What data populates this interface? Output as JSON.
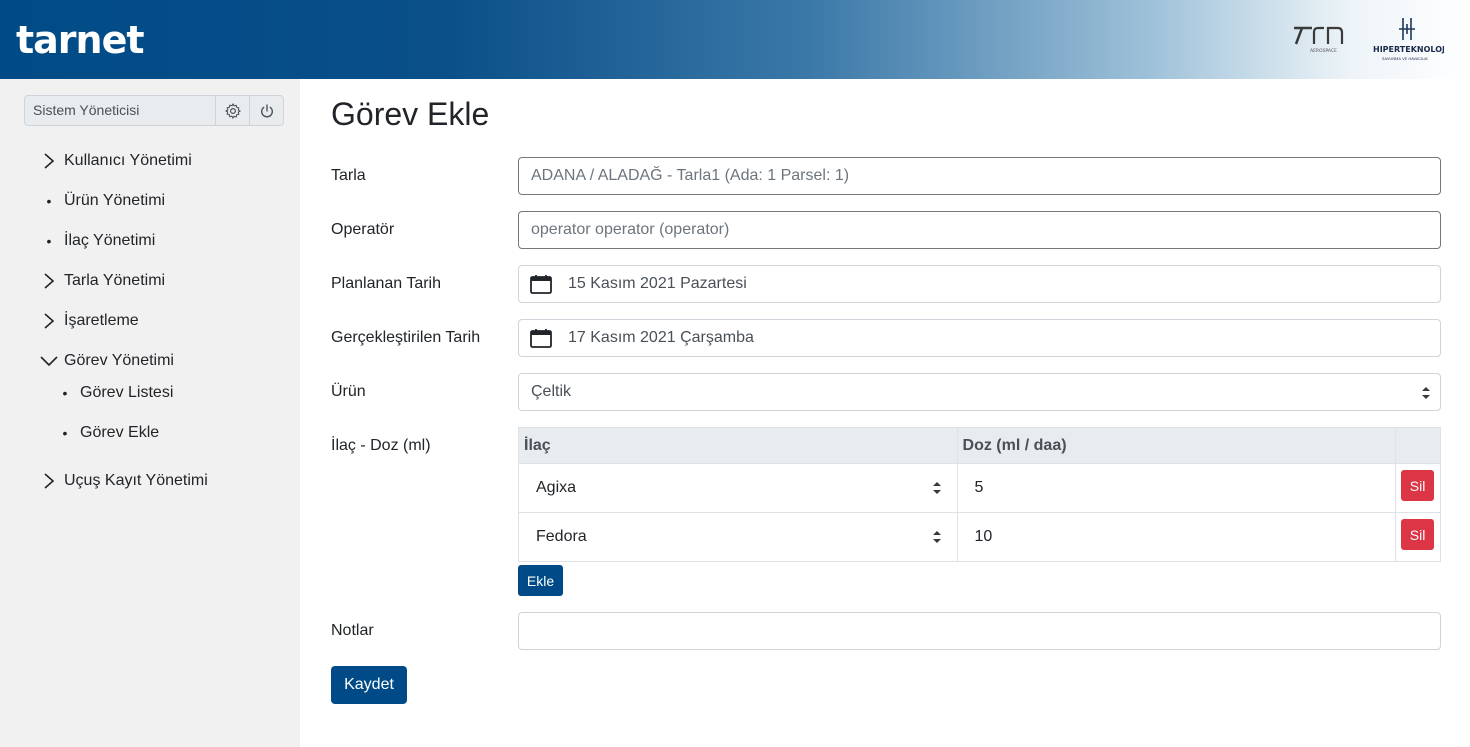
{
  "header": {
    "brand": "tarnet",
    "logo_trn": "TRN",
    "logo_trn_sub": "AEROSPACE",
    "logo_hiper": "HIPERTEKNOLOJI",
    "logo_hiper_sub": "SAVUNMA VE HAVACILIK"
  },
  "sidebar": {
    "user": "Sistem Yöneticisi",
    "settings_icon": "gear-icon",
    "power_icon": "power-icon",
    "items": [
      {
        "label": "Kullanıcı Yönetimi",
        "marker": "chevron-right"
      },
      {
        "label": "Ürün Yönetimi",
        "marker": "bullet"
      },
      {
        "label": "İlaç Yönetimi",
        "marker": "bullet"
      },
      {
        "label": "Tarla Yönetimi",
        "marker": "chevron-right"
      },
      {
        "label": "İşaretleme",
        "marker": "chevron-right"
      },
      {
        "label": "Görev Yönetimi",
        "marker": "chevron-down"
      },
      {
        "label": "Uçuş Kayıt Yönetimi",
        "marker": "chevron-right"
      }
    ],
    "subitems": [
      {
        "label": "Görev Listesi"
      },
      {
        "label": "Görev Ekle"
      }
    ]
  },
  "main": {
    "title": "Görev Ekle",
    "fields": {
      "tarla": {
        "label": "Tarla",
        "value": "ADANA / ALADAĞ - Tarla1 (Ada: 1 Parsel: 1)"
      },
      "operator": {
        "label": "Operatör",
        "value": "operator operator (operator)"
      },
      "planlanan": {
        "label": "Planlanan Tarih",
        "value": "15 Kasım 2021 Pazartesi"
      },
      "gerceklestirilen": {
        "label": "Gerçekleştirilen Tarih",
        "value": "17 Kasım 2021 Çarşamba"
      },
      "urun": {
        "label": "Ürün",
        "value": "Çeltik"
      },
      "ilac_doz": {
        "label": "İlaç - Doz (ml)"
      },
      "notlar": {
        "label": "Notlar",
        "value": ""
      }
    },
    "table": {
      "headers": [
        "İlaç",
        "Doz (ml / daa)",
        ""
      ],
      "rows": [
        {
          "ilac": "Agixa",
          "doz": "5",
          "action": "Sil"
        },
        {
          "ilac": "Fedora",
          "doz": "10",
          "action": "Sil"
        }
      ]
    },
    "add_button": "Ekle",
    "save_button": "Kaydet"
  },
  "colors": {
    "primary": "#004b87",
    "danger": "#dc3545",
    "sidebar_bg": "#f1f1f1"
  }
}
